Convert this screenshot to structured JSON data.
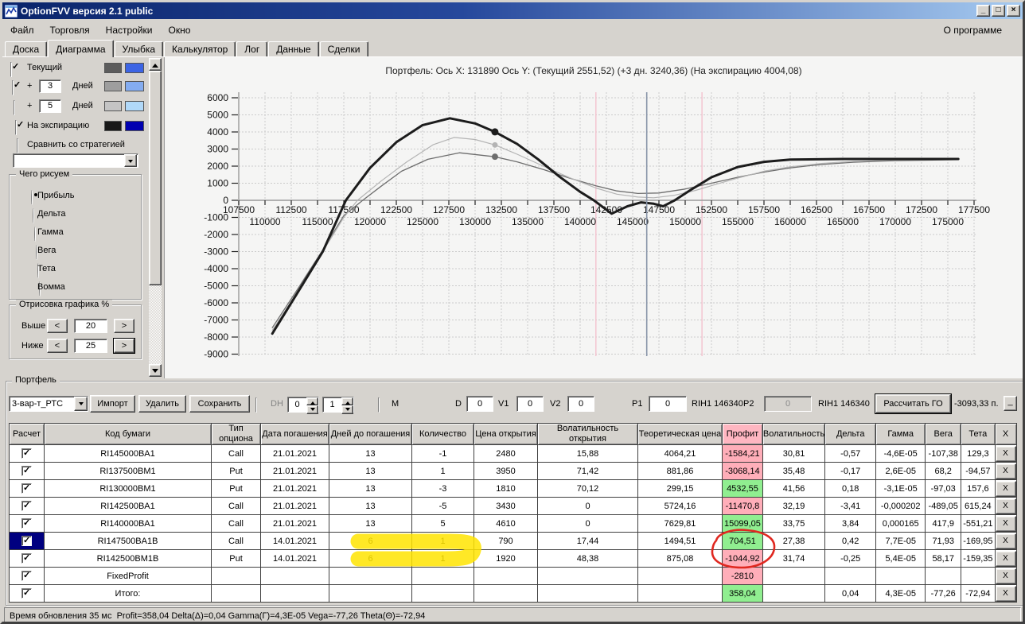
{
  "window": {
    "title": "OptionFVV версия 2.1 public",
    "controls": {
      "minimize": "_",
      "maximize": "□",
      "close": "×"
    }
  },
  "menu": {
    "items": [
      "Файл",
      "Торговля",
      "Настройки",
      "Окно"
    ],
    "right": "О программе"
  },
  "tabs": {
    "items": [
      "Доска",
      "Диаграмма",
      "Улыбка",
      "Калькулятор",
      "Лог",
      "Данные",
      "Сделки"
    ],
    "active": "Диаграмма"
  },
  "left_panel": {
    "curve_rows": [
      {
        "checked": true,
        "plus": "",
        "value": "",
        "label": "Текущий",
        "swatch1": "#5c5c5c",
        "swatch2": "#3c64e4"
      },
      {
        "checked": true,
        "plus": "+",
        "value": "3",
        "label": "Дней",
        "swatch1": "#9e9e9e",
        "swatch2": "#84acf0"
      },
      {
        "checked": false,
        "plus": "+",
        "value": "5",
        "label": "Дней",
        "swatch1": "#c4c4c4",
        "swatch2": "#b0d8f8"
      },
      {
        "checked": true,
        "plus": "",
        "value": "",
        "label": "На экспирацию",
        "swatch1": "#181818",
        "swatch2": "#0000b0"
      }
    ],
    "compare": {
      "checked": false,
      "label": "Сравнить со стратегией"
    },
    "strategy_dropdown_value": "",
    "draw_group": {
      "title": "Чего рисуем",
      "options": [
        "Прибыль",
        "Дельта",
        "Гамма",
        "Вега",
        "Тета",
        "Вомма"
      ],
      "selected": "Прибыль"
    },
    "render_group": {
      "title": "Отрисовка графика %",
      "dec_label": "<",
      "inc_label": ">",
      "rows": [
        {
          "label": "Выше",
          "value": "20"
        },
        {
          "label": "Ниже",
          "value": "25"
        }
      ]
    }
  },
  "chart_data": {
    "type": "line",
    "title": "Портфель: Ось X: 131890 Ось Y:  (Текущий 2551,52)  (+3 дн. 3240,36)  (На экспирацию 4004,08)",
    "xlabel": "",
    "ylabel": "",
    "x_range": [
      107500,
      177500
    ],
    "x_step": 2500,
    "x_label_step": 5000,
    "y_range": [
      -9000,
      6000
    ],
    "y_step": 1000,
    "grid": true,
    "vlines": [
      {
        "x": 141500,
        "color": "#f4c2ce",
        "name": "lower-strike-line"
      },
      {
        "x": 146340,
        "color": "#8894a8",
        "name": "current-price-line"
      },
      {
        "x": 151600,
        "color": "#f4c2ce",
        "name": "upper-strike-line"
      }
    ],
    "series": [
      {
        "name": "Текущий",
        "color": "#6e6e6e",
        "width": 1.3,
        "marker": {
          "x": 131890,
          "y": 2551.52,
          "r": 4
        },
        "points": [
          [
            110700,
            -7450
          ],
          [
            113000,
            -5300
          ],
          [
            115500,
            -2900
          ],
          [
            117500,
            -900
          ],
          [
            119300,
            0
          ],
          [
            121000,
            800
          ],
          [
            123000,
            1700
          ],
          [
            125500,
            2400
          ],
          [
            128500,
            2780
          ],
          [
            131890,
            2551
          ],
          [
            134000,
            2250
          ],
          [
            136500,
            1800
          ],
          [
            139000,
            1300
          ],
          [
            141500,
            850
          ],
          [
            143500,
            550
          ],
          [
            145500,
            400
          ],
          [
            147500,
            430
          ],
          [
            150000,
            660
          ],
          [
            152500,
            1000
          ],
          [
            155000,
            1350
          ],
          [
            157500,
            1650
          ],
          [
            160000,
            1900
          ],
          [
            163000,
            2100
          ],
          [
            166000,
            2230
          ],
          [
            170000,
            2320
          ],
          [
            176000,
            2380
          ]
        ]
      },
      {
        "name": "+3 Дней",
        "color": "#b4b4b4",
        "width": 1.2,
        "marker": {
          "x": 131890,
          "y": 3240.36,
          "r": 3.5
        },
        "points": [
          [
            110700,
            -7600
          ],
          [
            113000,
            -5450
          ],
          [
            115500,
            -3000
          ],
          [
            117500,
            -1000
          ],
          [
            118800,
            0
          ],
          [
            121000,
            1100
          ],
          [
            123500,
            2250
          ],
          [
            126000,
            3250
          ],
          [
            128000,
            3680
          ],
          [
            130000,
            3560
          ],
          [
            131890,
            3240
          ],
          [
            134000,
            2700
          ],
          [
            136500,
            2000
          ],
          [
            139000,
            1320
          ],
          [
            141500,
            720
          ],
          [
            143500,
            360
          ],
          [
            145500,
            190
          ],
          [
            147000,
            150
          ],
          [
            149000,
            300
          ],
          [
            151000,
            580
          ],
          [
            153000,
            950
          ],
          [
            155000,
            1300
          ],
          [
            157500,
            1700
          ],
          [
            160000,
            1960
          ],
          [
            163000,
            2160
          ],
          [
            166000,
            2280
          ],
          [
            170000,
            2360
          ],
          [
            176000,
            2400
          ]
        ]
      },
      {
        "name": "На экспирацию",
        "color": "#1c1c1c",
        "width": 3,
        "marker": {
          "x": 131890,
          "y": 4004.08,
          "r": 4.5
        },
        "points": [
          [
            110700,
            -7800
          ],
          [
            113000,
            -5500
          ],
          [
            115500,
            -3000
          ],
          [
            117700,
            0
          ],
          [
            120000,
            1900
          ],
          [
            122500,
            3400
          ],
          [
            125000,
            4400
          ],
          [
            127600,
            4800
          ],
          [
            130000,
            4500
          ],
          [
            131890,
            4004
          ],
          [
            134000,
            3300
          ],
          [
            136000,
            2400
          ],
          [
            138000,
            1400
          ],
          [
            140000,
            500
          ],
          [
            141300,
            0
          ],
          [
            143000,
            -780
          ],
          [
            144500,
            -350
          ],
          [
            145800,
            -120
          ],
          [
            147000,
            -200
          ],
          [
            147900,
            -350
          ],
          [
            149000,
            0
          ],
          [
            150500,
            600
          ],
          [
            152500,
            1350
          ],
          [
            155000,
            1950
          ],
          [
            157500,
            2250
          ],
          [
            160000,
            2380
          ],
          [
            165000,
            2420
          ],
          [
            176000,
            2420
          ]
        ]
      }
    ]
  },
  "portfolio": {
    "group_label": "Портфель",
    "toolbar": {
      "variant": "3-вар-т_РТС",
      "import": "Импорт",
      "delete": "Удалить",
      "save": "Сохранить",
      "dh_label": "DH",
      "dh_checked": false,
      "spin1": "0",
      "spin2": "1",
      "m_label": "M",
      "m_checked": false,
      "d_label": "D",
      "d_value": "0",
      "v1_label": "V1",
      "v1_value": "0",
      "v2_label": "V2",
      "v2_value": "0",
      "p1_label": "P1",
      "p1_value": "0",
      "rih1_a": "RIH1 146340",
      "p2_label": "P2",
      "p2_value": "0",
      "rih1_b": "RIH1 146340",
      "calc_button": "Рассчитать ГО",
      "margin_value": "-3093,33 п.",
      "min_button": "_"
    },
    "table": {
      "headers": [
        "Расчет",
        "Код бумаги",
        "Тип опциона",
        "Дата погашения",
        "Дней до погашения",
        "Количество",
        "Цена открытия",
        "Волатильность открытия",
        "Теоретическая цена",
        "Профит",
        "Волатильность",
        "Дельта",
        "Гамма",
        "Вега",
        "Тета",
        "X"
      ],
      "x_button_label": "X",
      "rows": [
        {
          "checked": true,
          "selected": false,
          "code": "RI145000BA1",
          "type": "Call",
          "date": "21.01.2021",
          "days": "13",
          "qty": "-1",
          "open_price": "2480",
          "open_vol": "15,88",
          "theo": "4064,21",
          "profit": "-1584,21",
          "profit_state": "neg",
          "vol": "30,81",
          "delta": "-0,57",
          "gamma": "-4,6E-05",
          "vega": "-107,38",
          "theta": "129,3"
        },
        {
          "checked": true,
          "selected": false,
          "code": "RI137500BM1",
          "type": "Put",
          "date": "21.01.2021",
          "days": "13",
          "qty": "1",
          "open_price": "3950",
          "open_vol": "71,42",
          "theo": "881,86",
          "profit": "-3068,14",
          "profit_state": "neg",
          "vol": "35,48",
          "delta": "-0,17",
          "gamma": "2,6E-05",
          "vega": "68,2",
          "theta": "-94,57"
        },
        {
          "checked": true,
          "selected": false,
          "code": "RI130000BM1",
          "type": "Put",
          "date": "21.01.2021",
          "days": "13",
          "qty": "-3",
          "open_price": "1810",
          "open_vol": "70,12",
          "theo": "299,15",
          "profit": "4532,55",
          "profit_state": "pos",
          "vol": "41,56",
          "delta": "0,18",
          "gamma": "-3,1E-05",
          "vega": "-97,03",
          "theta": "157,6"
        },
        {
          "checked": true,
          "selected": false,
          "code": "RI142500BA1",
          "type": "Call",
          "date": "21.01.2021",
          "days": "13",
          "qty": "-5",
          "open_price": "3430",
          "open_vol": "0",
          "theo": "5724,16",
          "profit": "-11470,8",
          "profit_state": "neg",
          "vol": "32,19",
          "delta": "-3,41",
          "gamma": "-0,000202",
          "vega": "-489,05",
          "theta": "615,24"
        },
        {
          "checked": true,
          "selected": false,
          "code": "RI140000BA1",
          "type": "Call",
          "date": "21.01.2021",
          "days": "13",
          "qty": "5",
          "open_price": "4610",
          "open_vol": "0",
          "theo": "7629,81",
          "profit": "15099,05",
          "profit_state": "pos",
          "vol": "33,75",
          "delta": "3,84",
          "gamma": "0,000165",
          "vega": "417,9",
          "theta": "-551,21"
        },
        {
          "checked": true,
          "selected": true,
          "code": "RI147500BA1B",
          "type": "Call",
          "date": "14.01.2021",
          "days": "6",
          "qty": "1",
          "open_price": "790",
          "open_vol": "17,44",
          "theo": "1494,51",
          "profit": "704,51",
          "profit_state": "pos",
          "vol": "27,38",
          "delta": "0,42",
          "gamma": "7,7E-05",
          "vega": "71,93",
          "theta": "-169,95"
        },
        {
          "checked": true,
          "selected": false,
          "code": "RI142500BM1B",
          "type": "Put",
          "date": "14.01.2021",
          "days": "6",
          "qty": "1",
          "open_price": "1920",
          "open_vol": "48,38",
          "theo": "875,08",
          "profit": "-1044,92",
          "profit_state": "neg",
          "vol": "31,74",
          "delta": "-0,25",
          "gamma": "5,4E-05",
          "vega": "58,17",
          "theta": "-159,35"
        },
        {
          "checked": true,
          "selected": false,
          "code": "FixedProfit",
          "type": "",
          "date": "",
          "days": "",
          "qty": "",
          "open_price": "",
          "open_vol": "",
          "theo": "",
          "profit": "-2810",
          "profit_state": "neg",
          "vol": "",
          "delta": "",
          "gamma": "",
          "vega": "",
          "theta": ""
        },
        {
          "checked": true,
          "selected": false,
          "code": "Итого:",
          "type": "",
          "date": "",
          "days": "",
          "qty": "",
          "open_price": "",
          "open_vol": "",
          "theo": "",
          "profit": "358,04",
          "profit_state": "pos",
          "vol": "",
          "delta": "0,04",
          "gamma": "4,3E-05",
          "vega": "-77,26",
          "theta": "-72,94"
        }
      ]
    },
    "annotations": {
      "highlighter_color": "#ffe400",
      "circle_color": "#e02820"
    }
  },
  "status_bar": {
    "text": "Время обновления 35 мс  Profit=358,04 Delta(Δ)=0,04 Gamma(Γ)=4,3E-05 Vega=-77,26 Theta(Θ)=-72,94"
  }
}
